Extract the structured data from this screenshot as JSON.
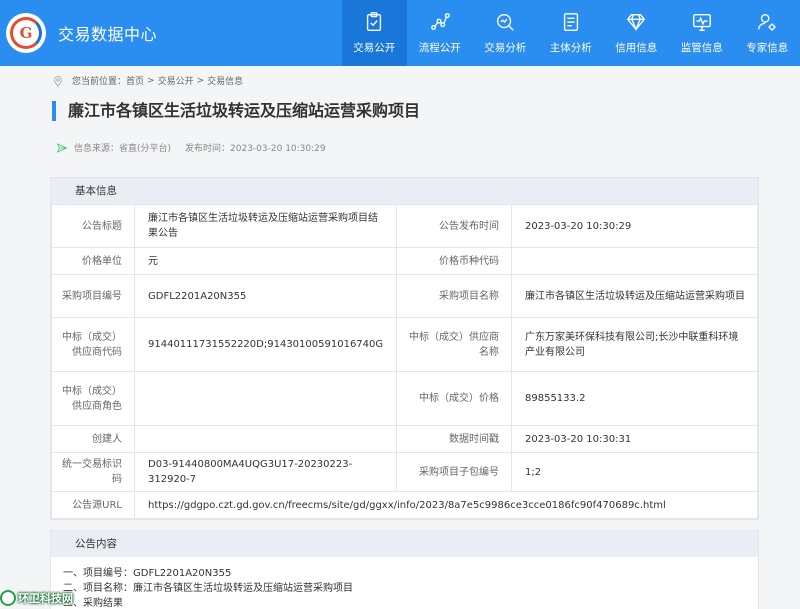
{
  "header": {
    "site_title": "交易数据中心",
    "logo_letter": "G",
    "nav": [
      {
        "label": "交易公开",
        "icon": "clipboard-check-icon",
        "active": true
      },
      {
        "label": "流程公开",
        "icon": "flow-nodes-icon",
        "active": false
      },
      {
        "label": "交易分析",
        "icon": "magnifier-chart-icon",
        "active": false
      },
      {
        "label": "主体分析",
        "icon": "document-list-icon",
        "active": false
      },
      {
        "label": "信用信息",
        "icon": "diamond-icon",
        "active": false
      },
      {
        "label": "监管信息",
        "icon": "monitor-pulse-icon",
        "active": false
      },
      {
        "label": "专家信息",
        "icon": "user-gear-icon",
        "active": false
      }
    ]
  },
  "breadcrumb": {
    "prefix": "您当前位置：",
    "items": [
      "首页",
      "交易公开",
      "交易信息"
    ],
    "separator": ">"
  },
  "page_title": "廉江市各镇区生活垃圾转运及压缩站运营采购项目",
  "meta": {
    "source": "信息来源：省直(分平台)",
    "published": "发布时间：2023-03-20 10:30:29"
  },
  "basic_info": {
    "heading": "基本信息",
    "rows": [
      {
        "k1": "公告标题",
        "v1": "廉江市各镇区生活垃圾转运及压缩站运营采购项目结果公告",
        "k2": "公告发布时间",
        "v2": "2023-03-20 10:30:29"
      },
      {
        "k1": "价格单位",
        "v1": "元",
        "k2": "价格币种代码",
        "v2": ""
      },
      {
        "k1": "采购项目编号",
        "v1": "GDFL2201A20N355",
        "k2": "采购项目名称",
        "v2": "廉江市各镇区生活垃圾转运及压缩站运营采购项目"
      },
      {
        "k1": "中标（成交）供应商代码",
        "v1": "91440111731552220D;91430100591016740G",
        "k2": "中标（成交）供应商名称",
        "v2": "广东万家美环保科技有限公司;长沙中联重科环境产业有限公司"
      },
      {
        "k1": "中标（成交）供应商角色",
        "v1": "",
        "k2": "中标（成交）价格",
        "v2": "89855133.2"
      },
      {
        "k1": "创建人",
        "v1": "",
        "k2": "数据时间戳",
        "v2": "2023-03-20 10:30:31"
      },
      {
        "k1": "统一交易标识码",
        "v1": "D03-91440800MA4UQG3U17-20230223-312920-7",
        "k2": "采购项目子包编号",
        "v2": "1;2"
      }
    ],
    "url_row": {
      "k": "公告源URL",
      "v": "https://gdgpo.czt.gd.gov.cn/freecms/site/gd/ggxx/info/2023/8a7e5c9986ce3cce0186fc90f470689c.html"
    }
  },
  "notice_content": {
    "heading": "公告内容",
    "lines": [
      "一、项目编号：GDFL2201A20N355",
      "二、项目名称：廉江市各镇区生活垃圾转运及压缩站运营采购项目",
      "三、采购结果"
    ]
  },
  "watermark": "环卫科技网",
  "colors": {
    "primary": "#2a8df0",
    "active_nav": "#1877d8",
    "accent_green": "#3cbf6a"
  }
}
